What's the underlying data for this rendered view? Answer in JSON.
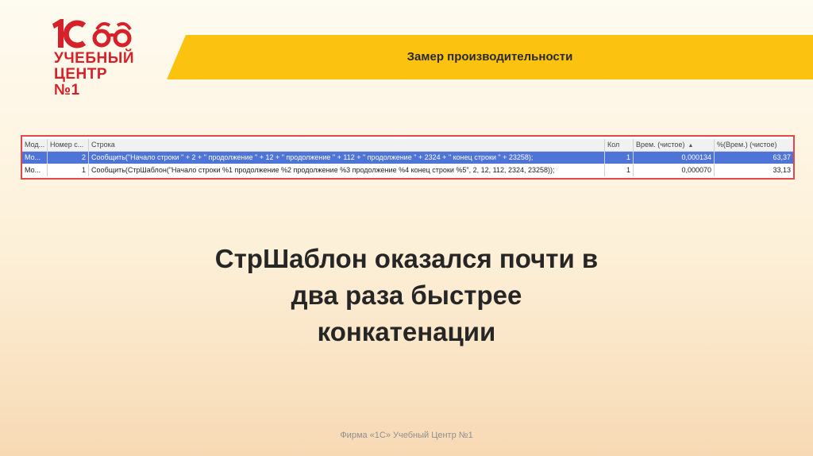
{
  "logo": {
    "mark": "1С",
    "line1": "УЧЕБНЫЙ",
    "line2": "ЦЕНТР №1",
    "color": "#d6202a"
  },
  "banner": {
    "title": "Замер производительности",
    "color": "#fbc20f"
  },
  "table": {
    "columns": [
      "Мод...",
      "Номер с...",
      "Строка",
      "Кол",
      "Врем. (чистое)",
      "%(Врем.) (чистое)"
    ],
    "sort_icon": "sort-ascending-icon",
    "rows": [
      [
        "Мо...",
        "2",
        "Сообщить(\"Начало строки \" + 2 + \" продолжение \" + 12 + \" продолжение \" + 112 + \" продолжение \" + 2324 + \" конец строки \" + 23258);",
        "1",
        "0,000134",
        "63,37"
      ],
      [
        "Мо...",
        "1",
        "Сообщить(СтрШаблон(\"Начало строки %1 продолжение %2 продолжение %3 продолжение %4 конец строки %5\", 2, 12, 112, 2324, 23258));",
        "1",
        "0,000070",
        "33,13"
      ]
    ],
    "selected_row_color": "#4f74d8"
  },
  "main": {
    "line1": "СтрШаблон оказался почти в",
    "line2": "два раза быстрее",
    "line3": "конкатенации"
  },
  "footer": {
    "text": "Фирма «1С» Учебный Центр №1"
  }
}
